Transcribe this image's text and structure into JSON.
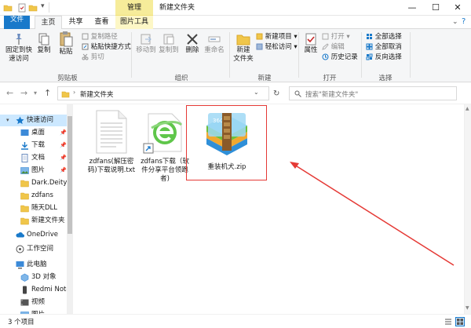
{
  "titlebar": {
    "context_tab": "管理",
    "title": "新建文件夹",
    "minimize": "—",
    "maximize": "☐",
    "close": "✕"
  },
  "tabs": [
    "文件",
    "主页",
    "共享",
    "查看",
    "图片工具"
  ],
  "ribbon": {
    "clipboard": {
      "pin_label_1": "固定到快",
      "pin_label_2": "速访问",
      "copy": "复制",
      "paste": "粘贴",
      "copy_path": "复制路径",
      "paste_shortcut": "粘贴快捷方式",
      "cut": "剪切",
      "group": "剪贴板"
    },
    "organize": {
      "move_to": "移动到",
      "copy_to": "复制到",
      "delete": "删除",
      "rename": "重命名",
      "group": "组织"
    },
    "new": {
      "new_folder_1": "新建",
      "new_folder_2": "文件夹",
      "new_item": "新建项目",
      "easy_access": "轻松访问",
      "group": "新建"
    },
    "open": {
      "properties": "属性",
      "open": "打开",
      "edit": "编辑",
      "history": "历史记录",
      "group": "打开"
    },
    "select": {
      "select_all": "全部选择",
      "select_none": "全部取消",
      "invert": "反向选择",
      "group": "选择"
    }
  },
  "address": {
    "path": "新建文件夹",
    "search_placeholder": "搜索\"新建文件夹\""
  },
  "nav": {
    "items": [
      "快速访问",
      "桌面",
      "下载",
      "文档",
      "图片",
      "Dark.Deity.v",
      "zdfans",
      "随天DLL",
      "新建文件夹",
      "OneDrive",
      "工作空间",
      "此电脑",
      "3D 对象",
      "Redmi Note",
      "视频",
      "图片"
    ]
  },
  "files": [
    {
      "name_1": "zdfans(解压密",
      "name_2": "码)下载说明.txt",
      "icon": "text-file-icon"
    },
    {
      "name_1": "zdfans下载（软",
      "name_2": "件分享平台领跑",
      "name_3": "者)",
      "icon": "ie-shortcut-icon"
    },
    {
      "name_1": "重装机犬.zip",
      "icon": "zip-archive-icon"
    }
  ],
  "status": {
    "count": "3 个项目"
  },
  "colors": {
    "accent": "#1979ca",
    "selection": "#cce8ff",
    "highlight_box": "#e53935"
  }
}
